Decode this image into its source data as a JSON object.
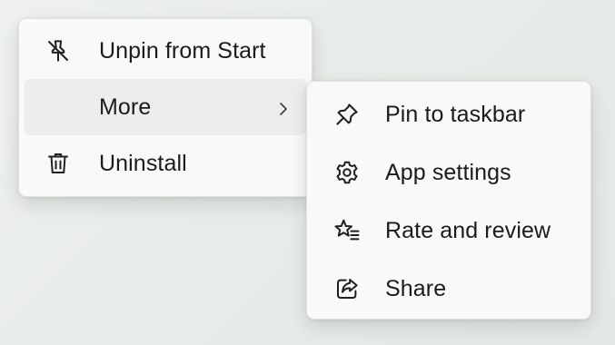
{
  "main_menu": {
    "items": [
      {
        "label": "Unpin from Start",
        "icon": "unpin-icon"
      },
      {
        "label": "More",
        "icon": "",
        "has_submenu": true
      },
      {
        "label": "Uninstall",
        "icon": "trash-icon"
      }
    ]
  },
  "submenu": {
    "items": [
      {
        "label": "Pin to taskbar",
        "icon": "pin-icon"
      },
      {
        "label": "App settings",
        "icon": "gear-icon"
      },
      {
        "label": "Rate and review",
        "icon": "star-list-icon"
      },
      {
        "label": "Share",
        "icon": "share-icon"
      }
    ]
  },
  "colors": {
    "menu_background": "#f9f9f9",
    "hover_background": "#ededed",
    "text": "#1b1b1b"
  }
}
